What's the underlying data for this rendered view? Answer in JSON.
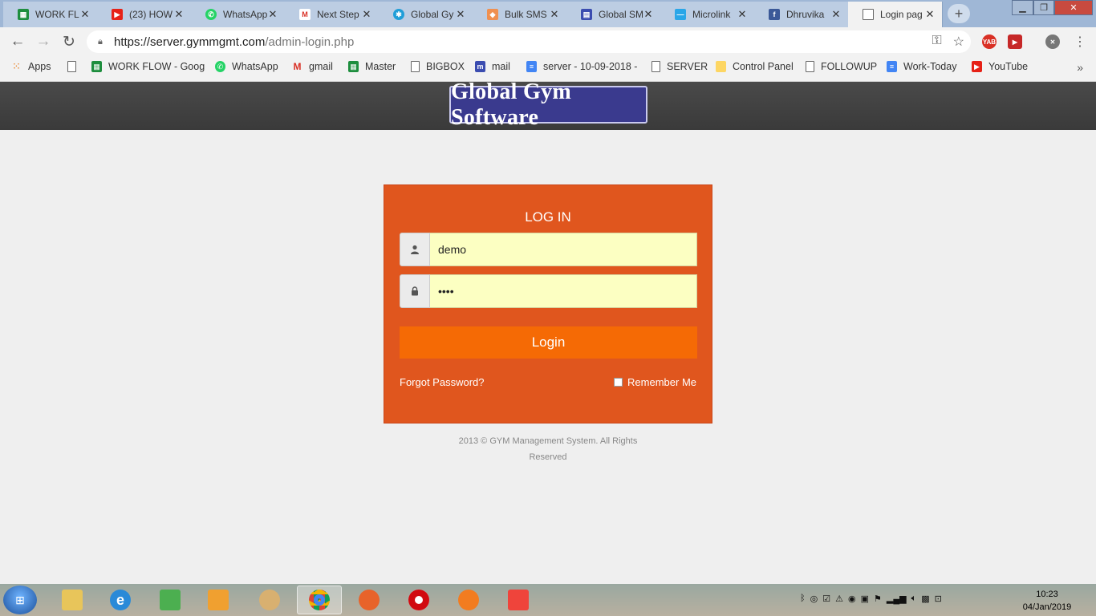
{
  "tabs": [
    {
      "label": "WORK FLO",
      "icon": "sheets-icon",
      "color": "#1e8e3e"
    },
    {
      "label": "(23) HOW",
      "icon": "youtube-icon",
      "color": "#e62117"
    },
    {
      "label": "WhatsApp",
      "icon": "whatsapp-icon",
      "color": "#25d366"
    },
    {
      "label": "Next Step",
      "icon": "gmail-icon",
      "color": "#d93025"
    },
    {
      "label": "Global Gy",
      "icon": "globe-icon",
      "color": "#1f9ed8"
    },
    {
      "label": "Bulk SMS",
      "icon": "pin-icon",
      "color": "#f09050"
    },
    {
      "label": "Global SM",
      "icon": "keyboard-icon",
      "color": "#3b4cb0"
    },
    {
      "label": "Microlink",
      "icon": "link-icon",
      "color": "#2aa6e8"
    },
    {
      "label": "Dhruvika",
      "icon": "facebook-icon",
      "color": "#3b5998"
    },
    {
      "label": "Login pag",
      "icon": "page-icon",
      "color": "#888888"
    }
  ],
  "close_glyph": "✕",
  "new_tab_glyph": "+",
  "address": {
    "host": "https://server.gymmgmt.com",
    "path": "/admin-login.php"
  },
  "extensions": [
    {
      "label": "YAB",
      "color": "#d93025"
    },
    {
      "label": "▶",
      "color": "#c62828"
    },
    {
      "label": "✕",
      "color": "#777777"
    }
  ],
  "bookmarks": [
    {
      "label": "Apps",
      "icon": "apps-grid-icon",
      "color": "#e8710a"
    },
    {
      "label": "",
      "icon": "page-icon",
      "color": "#ffffff"
    },
    {
      "label": "WORK FLOW - Goog",
      "icon": "sheets-icon",
      "color": "#1e8e3e"
    },
    {
      "label": "WhatsApp",
      "icon": "whatsapp-icon",
      "color": "#25d366"
    },
    {
      "label": "gmail",
      "icon": "gmail-icon",
      "color": "#d93025"
    },
    {
      "label": "Master",
      "icon": "sheets-icon",
      "color": "#1e8e3e"
    },
    {
      "label": "BIGBOX",
      "icon": "page-icon",
      "color": "#ffffff"
    },
    {
      "label": "mail",
      "icon": "mail-m-icon",
      "color": "#3b4cb0"
    },
    {
      "label": "server - 10-09-2018 -",
      "icon": "docs-icon",
      "color": "#4285f4"
    },
    {
      "label": "SERVER",
      "icon": "page-icon",
      "color": "#ffffff"
    },
    {
      "label": "Control Panel",
      "icon": "note-icon",
      "color": "#fdd663"
    },
    {
      "label": "FOLLOWUP",
      "icon": "page-icon",
      "color": "#ffffff"
    },
    {
      "label": "Work-Today",
      "icon": "docs-icon",
      "color": "#4285f4"
    },
    {
      "label": "YouTube",
      "icon": "youtube-icon",
      "color": "#e62117"
    }
  ],
  "site": {
    "logo_text": "Global Gym Software"
  },
  "login": {
    "title": "LOG IN",
    "username_value": "demo",
    "password_value": "••••",
    "button_label": "Login",
    "forgot_label": "Forgot Password?",
    "remember_label": "Remember Me"
  },
  "footer": {
    "line1": "2013 © GYM Management System. All Rights",
    "line2": "Reserved"
  },
  "clock": {
    "time": "10:23",
    "date": "04/Jan/2019"
  },
  "colors": {
    "login_panel": "#e0561e",
    "login_button": "#f56a05",
    "input_fill": "#fcffc2",
    "logo_bg": "#3a3a8e"
  }
}
